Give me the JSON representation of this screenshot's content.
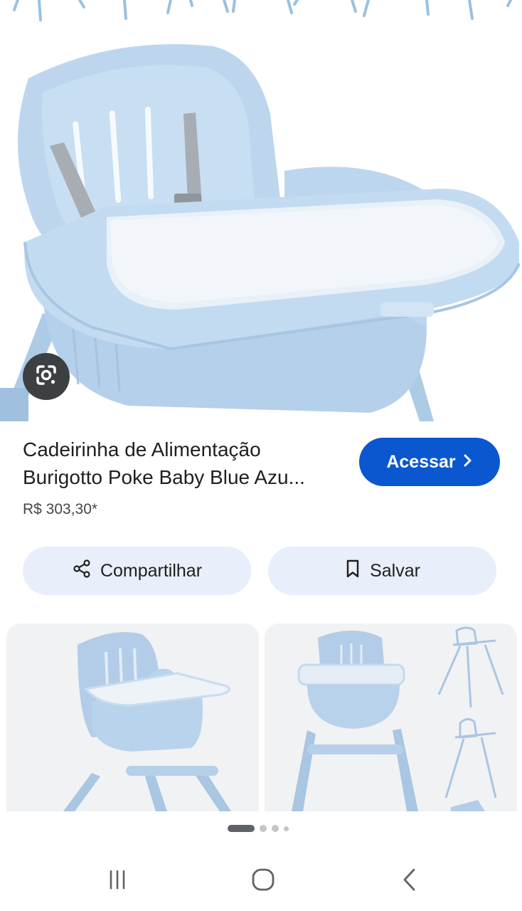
{
  "product": {
    "title_line1": "Cadeirinha de Alimentação",
    "title_line2": "Burigotto Poke Baby Blue Azu...",
    "price": "R$ 303,30*"
  },
  "buttons": {
    "visit_label": "Acessar",
    "share_label": "Compartilhar",
    "save_label": "Salvar"
  },
  "icons": {
    "lens": "google-lens-icon",
    "visit_chevron": "chevron-right-icon",
    "share": "share-icon",
    "save": "bookmark-icon",
    "nav_recents": "recents-icon",
    "nav_home": "home-icon",
    "nav_back": "back-icon"
  },
  "carousel": {
    "page_count": 4,
    "active_index": 0
  },
  "colors": {
    "accent": "#0b57d0",
    "action_bg": "#e8eefa",
    "chair_blue": "#b9d2ea"
  }
}
